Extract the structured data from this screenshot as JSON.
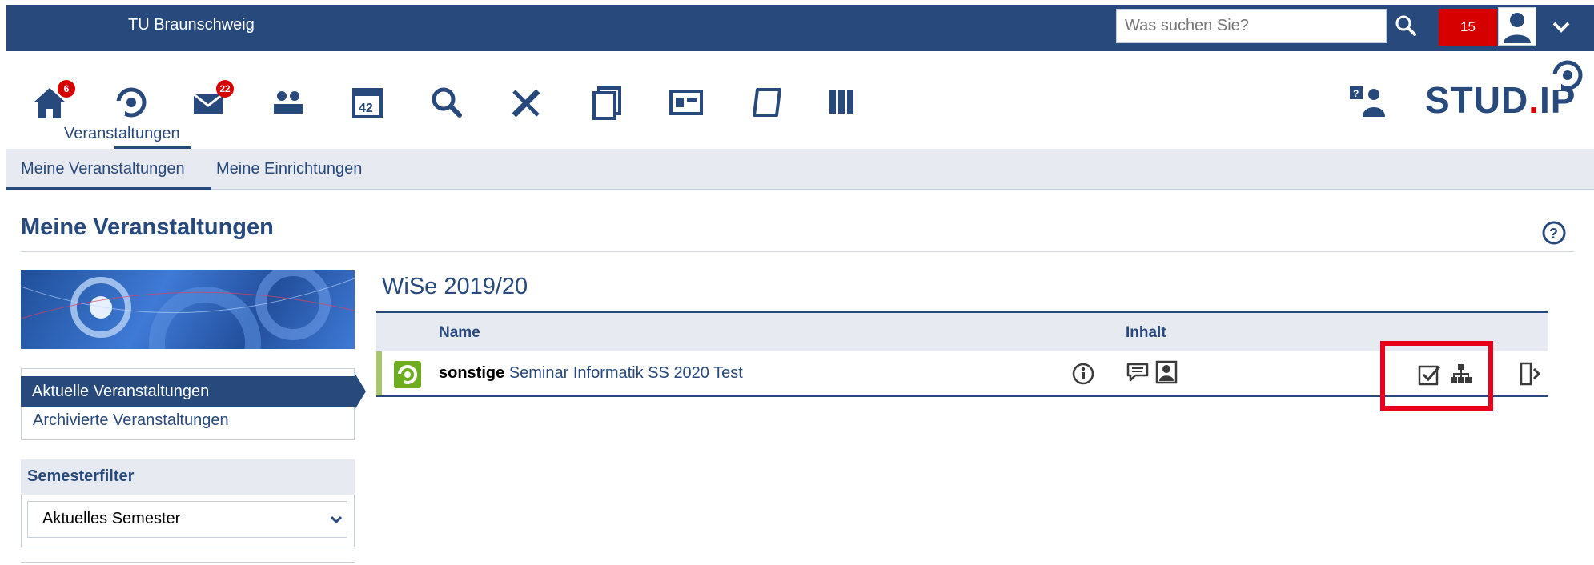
{
  "header": {
    "university": "TU Braunschweig",
    "search_placeholder": "Was suchen Sie?",
    "notification_count": "15",
    "colors": {
      "primary": "#28497c",
      "notification": "#d60000"
    }
  },
  "nav": {
    "icons": [
      "home-icon",
      "courses-icon",
      "messages-icon",
      "community-icon",
      "calendar-icon",
      "search-icon",
      "tools-icon",
      "files-icon",
      "schedule-icon",
      "wiki-icon",
      "library-icon"
    ],
    "badges": {
      "home": "6",
      "messages": "22"
    },
    "active_label": "Veranstaltungen",
    "logo": "STUD.IP"
  },
  "subnav": {
    "items": [
      "Meine Veranstaltungen",
      "Meine Einrichtungen"
    ]
  },
  "page": {
    "title": "Meine Veranstaltungen"
  },
  "sidebar": {
    "items": [
      "Aktuelle Veranstaltungen",
      "Archivierte Veranstaltungen"
    ],
    "filter_title": "Semesterfilter",
    "filter_value": "Aktuelles Semester"
  },
  "table": {
    "semester": "WiSe 2019/20",
    "headers": {
      "name": "Name",
      "content": "Inhalt"
    },
    "rows": [
      {
        "type": "sonstige",
        "title": "Seminar Informatik SS 2020 Test"
      }
    ]
  }
}
